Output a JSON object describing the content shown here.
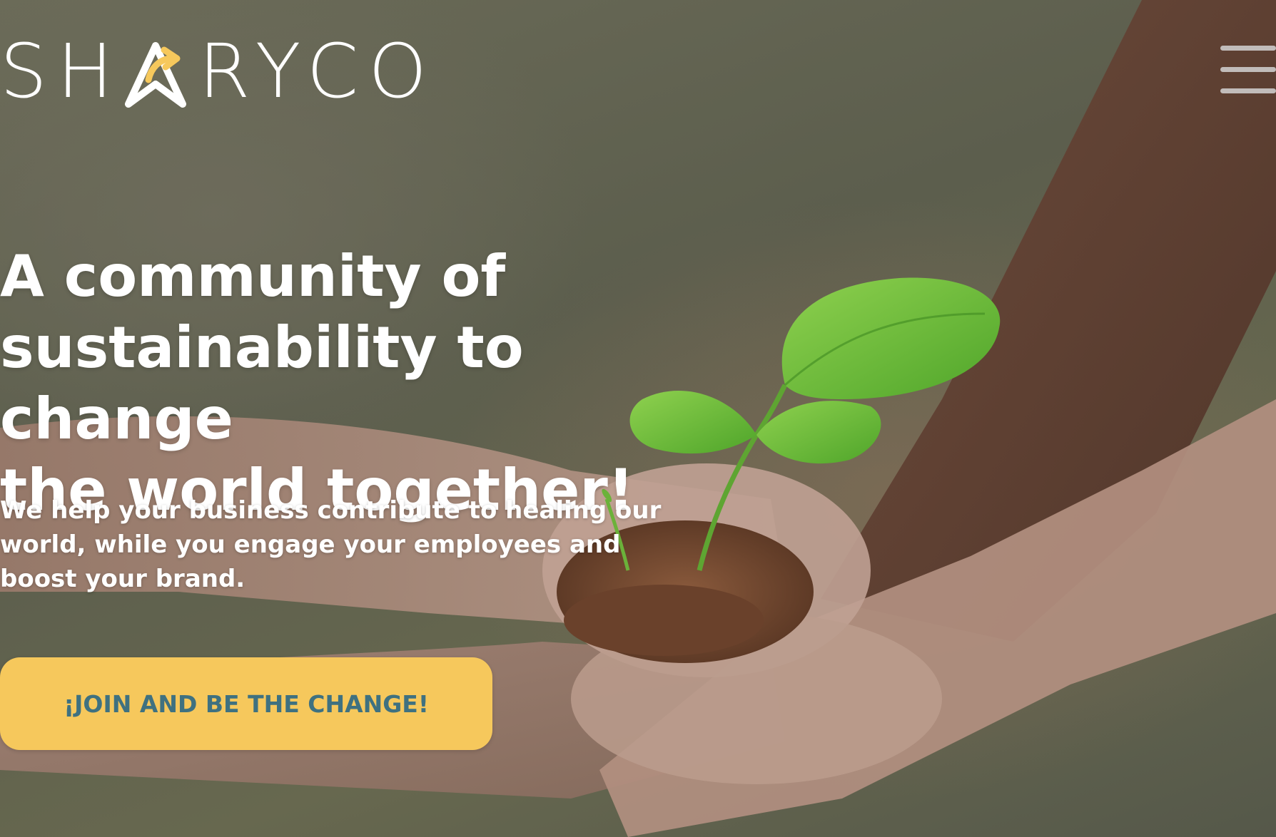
{
  "brand": {
    "logo_letters_before": "SH",
    "logo_letters_after": "RYCO",
    "logo_accent_color": "#f6c85c"
  },
  "nav": {
    "menu_icon": "hamburger-menu-icon"
  },
  "hero": {
    "headline_line1": "A community of",
    "headline_line2": "sustainability to change",
    "headline_line3": "the world together!",
    "subtext_line1": "We help your business contribute to healing our",
    "subtext_line2": "world, while you engage your employees and",
    "subtext_line3": "boost your brand.",
    "cta_label": "¡JOIN AND BE THE CHANGE!",
    "cta_color": "#f6c85c",
    "cta_text_color": "#3f7180"
  }
}
